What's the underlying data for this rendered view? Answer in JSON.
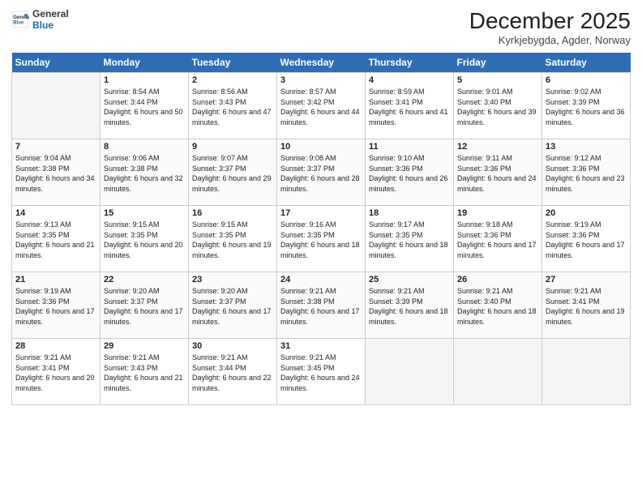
{
  "header": {
    "logo_line1": "General",
    "logo_line2": "Blue",
    "month_title": "December 2025",
    "location": "Kyrkjebygda, Agder, Norway"
  },
  "weekdays": [
    "Sunday",
    "Monday",
    "Tuesday",
    "Wednesday",
    "Thursday",
    "Friday",
    "Saturday"
  ],
  "weeks": [
    [
      {
        "day": "",
        "sunrise": "",
        "sunset": "",
        "daylight": ""
      },
      {
        "day": "1",
        "sunrise": "Sunrise: 8:54 AM",
        "sunset": "Sunset: 3:44 PM",
        "daylight": "Daylight: 6 hours and 50 minutes."
      },
      {
        "day": "2",
        "sunrise": "Sunrise: 8:56 AM",
        "sunset": "Sunset: 3:43 PM",
        "daylight": "Daylight: 6 hours and 47 minutes."
      },
      {
        "day": "3",
        "sunrise": "Sunrise: 8:57 AM",
        "sunset": "Sunset: 3:42 PM",
        "daylight": "Daylight: 6 hours and 44 minutes."
      },
      {
        "day": "4",
        "sunrise": "Sunrise: 8:59 AM",
        "sunset": "Sunset: 3:41 PM",
        "daylight": "Daylight: 6 hours and 41 minutes."
      },
      {
        "day": "5",
        "sunrise": "Sunrise: 9:01 AM",
        "sunset": "Sunset: 3:40 PM",
        "daylight": "Daylight: 6 hours and 39 minutes."
      },
      {
        "day": "6",
        "sunrise": "Sunrise: 9:02 AM",
        "sunset": "Sunset: 3:39 PM",
        "daylight": "Daylight: 6 hours and 36 minutes."
      }
    ],
    [
      {
        "day": "7",
        "sunrise": "Sunrise: 9:04 AM",
        "sunset": "Sunset: 3:38 PM",
        "daylight": "Daylight: 6 hours and 34 minutes."
      },
      {
        "day": "8",
        "sunrise": "Sunrise: 9:06 AM",
        "sunset": "Sunset: 3:38 PM",
        "daylight": "Daylight: 6 hours and 32 minutes."
      },
      {
        "day": "9",
        "sunrise": "Sunrise: 9:07 AM",
        "sunset": "Sunset: 3:37 PM",
        "daylight": "Daylight: 6 hours and 29 minutes."
      },
      {
        "day": "10",
        "sunrise": "Sunrise: 9:08 AM",
        "sunset": "Sunset: 3:37 PM",
        "daylight": "Daylight: 6 hours and 28 minutes."
      },
      {
        "day": "11",
        "sunrise": "Sunrise: 9:10 AM",
        "sunset": "Sunset: 3:36 PM",
        "daylight": "Daylight: 6 hours and 26 minutes."
      },
      {
        "day": "12",
        "sunrise": "Sunrise: 9:11 AM",
        "sunset": "Sunset: 3:36 PM",
        "daylight": "Daylight: 6 hours and 24 minutes."
      },
      {
        "day": "13",
        "sunrise": "Sunrise: 9:12 AM",
        "sunset": "Sunset: 3:36 PM",
        "daylight": "Daylight: 6 hours and 23 minutes."
      }
    ],
    [
      {
        "day": "14",
        "sunrise": "Sunrise: 9:13 AM",
        "sunset": "Sunset: 3:35 PM",
        "daylight": "Daylight: 6 hours and 21 minutes."
      },
      {
        "day": "15",
        "sunrise": "Sunrise: 9:15 AM",
        "sunset": "Sunset: 3:35 PM",
        "daylight": "Daylight: 6 hours and 20 minutes."
      },
      {
        "day": "16",
        "sunrise": "Sunrise: 9:15 AM",
        "sunset": "Sunset: 3:35 PM",
        "daylight": "Daylight: 6 hours and 19 minutes."
      },
      {
        "day": "17",
        "sunrise": "Sunrise: 9:16 AM",
        "sunset": "Sunset: 3:35 PM",
        "daylight": "Daylight: 6 hours and 18 minutes."
      },
      {
        "day": "18",
        "sunrise": "Sunrise: 9:17 AM",
        "sunset": "Sunset: 3:35 PM",
        "daylight": "Daylight: 6 hours and 18 minutes."
      },
      {
        "day": "19",
        "sunrise": "Sunrise: 9:18 AM",
        "sunset": "Sunset: 3:36 PM",
        "daylight": "Daylight: 6 hours and 17 minutes."
      },
      {
        "day": "20",
        "sunrise": "Sunrise: 9:19 AM",
        "sunset": "Sunset: 3:36 PM",
        "daylight": "Daylight: 6 hours and 17 minutes."
      }
    ],
    [
      {
        "day": "21",
        "sunrise": "Sunrise: 9:19 AM",
        "sunset": "Sunset: 3:36 PM",
        "daylight": "Daylight: 6 hours and 17 minutes."
      },
      {
        "day": "22",
        "sunrise": "Sunrise: 9:20 AM",
        "sunset": "Sunset: 3:37 PM",
        "daylight": "Daylight: 6 hours and 17 minutes."
      },
      {
        "day": "23",
        "sunrise": "Sunrise: 9:20 AM",
        "sunset": "Sunset: 3:37 PM",
        "daylight": "Daylight: 6 hours and 17 minutes."
      },
      {
        "day": "24",
        "sunrise": "Sunrise: 9:21 AM",
        "sunset": "Sunset: 3:38 PM",
        "daylight": "Daylight: 6 hours and 17 minutes."
      },
      {
        "day": "25",
        "sunrise": "Sunrise: 9:21 AM",
        "sunset": "Sunset: 3:39 PM",
        "daylight": "Daylight: 6 hours and 18 minutes."
      },
      {
        "day": "26",
        "sunrise": "Sunrise: 9:21 AM",
        "sunset": "Sunset: 3:40 PM",
        "daylight": "Daylight: 6 hours and 18 minutes."
      },
      {
        "day": "27",
        "sunrise": "Sunrise: 9:21 AM",
        "sunset": "Sunset: 3:41 PM",
        "daylight": "Daylight: 6 hours and 19 minutes."
      }
    ],
    [
      {
        "day": "28",
        "sunrise": "Sunrise: 9:21 AM",
        "sunset": "Sunset: 3:41 PM",
        "daylight": "Daylight: 6 hours and 20 minutes."
      },
      {
        "day": "29",
        "sunrise": "Sunrise: 9:21 AM",
        "sunset": "Sunset: 3:43 PM",
        "daylight": "Daylight: 6 hours and 21 minutes."
      },
      {
        "day": "30",
        "sunrise": "Sunrise: 9:21 AM",
        "sunset": "Sunset: 3:44 PM",
        "daylight": "Daylight: 6 hours and 22 minutes."
      },
      {
        "day": "31",
        "sunrise": "Sunrise: 9:21 AM",
        "sunset": "Sunset: 3:45 PM",
        "daylight": "Daylight: 6 hours and 24 minutes."
      },
      {
        "day": "",
        "sunrise": "",
        "sunset": "",
        "daylight": ""
      },
      {
        "day": "",
        "sunrise": "",
        "sunset": "",
        "daylight": ""
      },
      {
        "day": "",
        "sunrise": "",
        "sunset": "",
        "daylight": ""
      }
    ]
  ]
}
